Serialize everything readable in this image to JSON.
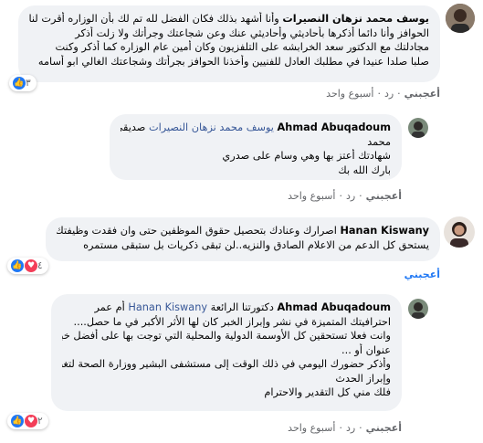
{
  "comments": [
    {
      "author": "يوسف محمد نزهان النصيرات",
      "lines": [
        "وأنا أشهد بذلك فكان الفضل لله تم لك بأن الوزاره أقرت لنا",
        "الحوافز وأنا دائما أذكرها بأحاديثي وأحاديثي عنك وعن شجاعتك وجرأتك ولا زلت أذكر",
        "مجادلتك مع الدكتور سعد الخرابشه على التلفزيون وكان أمين عام الوزاره كما أذكر وكنت",
        "صلبا صلدا عنيدا في مطلبك العادل للفنيين وأخذنا الحوافز بجرأتك وشجاعتك الغالي ابو أسامه"
      ],
      "reaction_count": "٣",
      "actions": {
        "like": "أعجبني",
        "reply": "رد",
        "time": "أسبوع واحد"
      }
    },
    {
      "author": "Ahmad Abuqadoum",
      "tag": "يوسف محمد نزهان النصيرات",
      "first_line_rest": "صديقي وزميلي أبا",
      "lines": [
        "محمد",
        "شهادتك أعتز بها وهي وسام على صدري",
        "بارك الله بك"
      ],
      "actions": {
        "like": "أعجبني",
        "reply": "رد",
        "time": "أسبوع واحد"
      }
    },
    {
      "author": "Hanan Kiswany",
      "first_line_rest": "اصرارك وعنادك بتحصيل حقوق الموظفين حتى وان فقدت وظيفتك",
      "lines": [
        "يستحق كل الدعم من الاعلام الصادق والنزيه..لن تبقى ذكريات بل ستبقى مستمره"
      ],
      "reaction_count": "٤",
      "actions": {
        "like": "أعجبني",
        "reply": "رد",
        "time": "أسبوع واحد"
      }
    },
    {
      "author": "Ahmad Abuqadoum",
      "tag": "Hanan Kiswany",
      "first_line_rest": "دكتورتنا الرائعة",
      "first_line_after": "أم عمر",
      "lines": [
        "احترافيتك المتميزة في نشر وإبراز الخبر كان لها الأثر الأكبر في ما حصل....",
        "وانت فعلا تستحقين كل الأوسمة الدولية والمحلية التي توجت بها على أفضل خبر أو",
        "عنوان أو ...",
        "وأذكر حضورك اليومي في ذلك الوقت إلى مستشفى البشير ووزارة الصحة لتغطية",
        "وإبراز الحدث",
        "فلك مني كل التقدير والاحترام"
      ],
      "reaction_count": "٢",
      "actions": {
        "like": "أعجبني",
        "reply": "رد",
        "time": "أسبوع واحد"
      }
    }
  ]
}
